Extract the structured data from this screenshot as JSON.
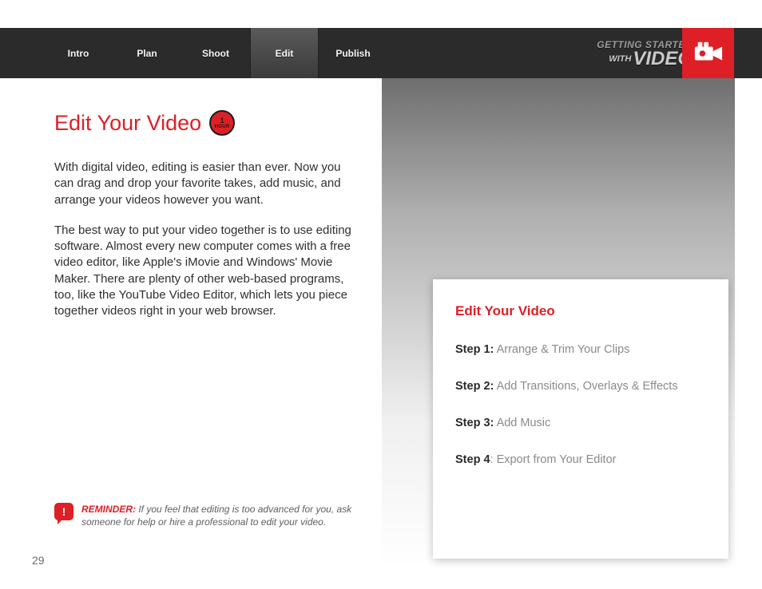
{
  "nav": {
    "items": [
      "Intro",
      "Plan",
      "Shoot",
      "Edit",
      "Publish"
    ],
    "activeIndex": 3
  },
  "brand": {
    "top": "GETTING STARTED",
    "withWord": "WITH",
    "main": "VIDEO"
  },
  "badge": {
    "number": "1",
    "unit": "HOUR"
  },
  "title": "Edit Your Video",
  "paragraphs": [
    "With digital video, editing is easier than ever. Now you can drag and drop your favorite takes, add music, and arrange your videos however you want.",
    "The best way to put your video together is to use editing software. Almost every new computer comes with a free video editor, like Apple's iMovie and Windows' Movie Maker. There are plenty of other web-based programs, too, like the YouTube Video Editor, which lets you piece together videos right in your web browser."
  ],
  "reminder": {
    "label": "REMINDER:",
    "text": " If you feel that editing is too advanced for you, ask someone for help or hire a professional to edit your video."
  },
  "pageNumber": "29",
  "card": {
    "title": "Edit Your Video",
    "steps": [
      {
        "label": "Step 1:",
        "text": " Arrange & Trim Your Clips"
      },
      {
        "label": "Step 2:",
        "text": " Add Transitions, Overlays & Effects"
      },
      {
        "label": "Step 3:",
        "text": " Add Music"
      },
      {
        "label": "Step 4",
        "text": ": Export from Your Editor"
      }
    ]
  }
}
